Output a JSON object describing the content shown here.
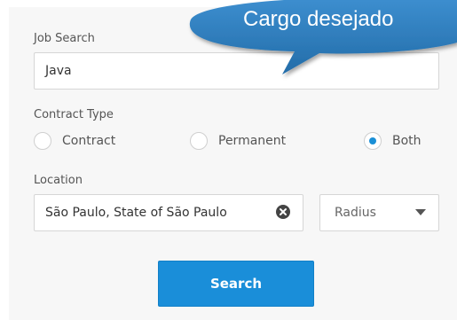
{
  "job_search": {
    "label": "Job Search",
    "value": "Java"
  },
  "contract_type": {
    "label": "Contract Type",
    "options": [
      {
        "label": "Contract",
        "checked": false
      },
      {
        "label": "Permanent",
        "checked": false
      },
      {
        "label": "Both",
        "checked": true
      }
    ]
  },
  "location": {
    "label": "Location",
    "value": "São Paulo, State of São Paulo",
    "clear_icon": "close-circle-icon"
  },
  "radius": {
    "selected": "Radius",
    "icon": "chevron-down-icon"
  },
  "search_button": {
    "label": "Search"
  },
  "callout": {
    "text": "Cargo desejado"
  },
  "colors": {
    "accent": "#1a8ed9",
    "callout": "#2f7fbe",
    "panel": "#f7f7f7"
  }
}
